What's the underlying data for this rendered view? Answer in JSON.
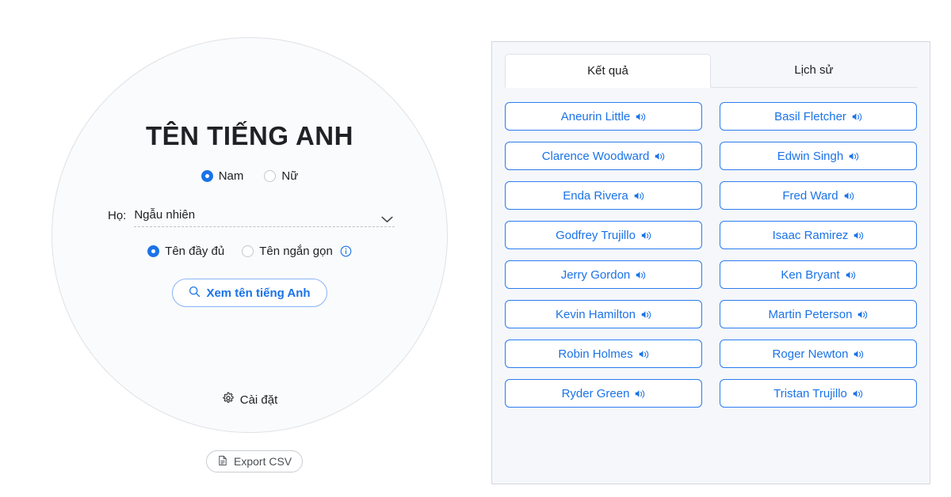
{
  "generator": {
    "title": "TÊN TIẾNG ANH",
    "gender_options": [
      {
        "label": "Nam",
        "selected": true
      },
      {
        "label": "Nữ",
        "selected": false
      }
    ],
    "surname": {
      "label": "Họ:",
      "value": "Ngẫu nhiên",
      "chevron_icon": "chevron-down-icon"
    },
    "name_length_options": [
      {
        "label": "Tên đầy đủ",
        "selected": true
      },
      {
        "label": "Tên ngắn gọn",
        "selected": false,
        "info_icon": "info-icon"
      }
    ],
    "search_button": {
      "label": "Xem tên tiếng Anh",
      "icon": "search-icon"
    },
    "settings_link": {
      "label": "Cài đặt",
      "icon": "gear-icon"
    },
    "export_button": {
      "label": "Export CSV",
      "icon": "document-icon"
    }
  },
  "results": {
    "tabs": [
      {
        "label": "Kết quả",
        "active": true
      },
      {
        "label": "Lịch sử",
        "active": false
      }
    ],
    "names": [
      {
        "name": "Aneurin Little",
        "icon": "speaker-icon"
      },
      {
        "name": "Basil Fletcher",
        "icon": "speaker-icon"
      },
      {
        "name": "Clarence Woodward",
        "icon": "speaker-icon"
      },
      {
        "name": "Edwin Singh",
        "icon": "speaker-icon"
      },
      {
        "name": "Enda Rivera",
        "icon": "speaker-icon"
      },
      {
        "name": "Fred Ward",
        "icon": "speaker-icon"
      },
      {
        "name": "Godfrey Trujillo",
        "icon": "speaker-icon"
      },
      {
        "name": "Isaac Ramirez",
        "icon": "speaker-icon"
      },
      {
        "name": "Jerry Gordon",
        "icon": "speaker-icon"
      },
      {
        "name": "Ken Bryant",
        "icon": "speaker-icon"
      },
      {
        "name": "Kevin Hamilton",
        "icon": "speaker-icon"
      },
      {
        "name": "Martin Peterson",
        "icon": "speaker-icon"
      },
      {
        "name": "Robin Holmes",
        "icon": "speaker-icon"
      },
      {
        "name": "Roger Newton",
        "icon": "speaker-icon"
      },
      {
        "name": "Ryder Green",
        "icon": "speaker-icon"
      },
      {
        "name": "Tristan Trujillo",
        "icon": "speaker-icon"
      }
    ]
  },
  "colors": {
    "accent_blue": "#1a73e8",
    "button_border_blue": "#2b7cf0",
    "panel_bg": "#f5f7fa",
    "panel_border": "#d3d8de",
    "circle_border": "#dfe1e5",
    "text_default": "#202124"
  }
}
